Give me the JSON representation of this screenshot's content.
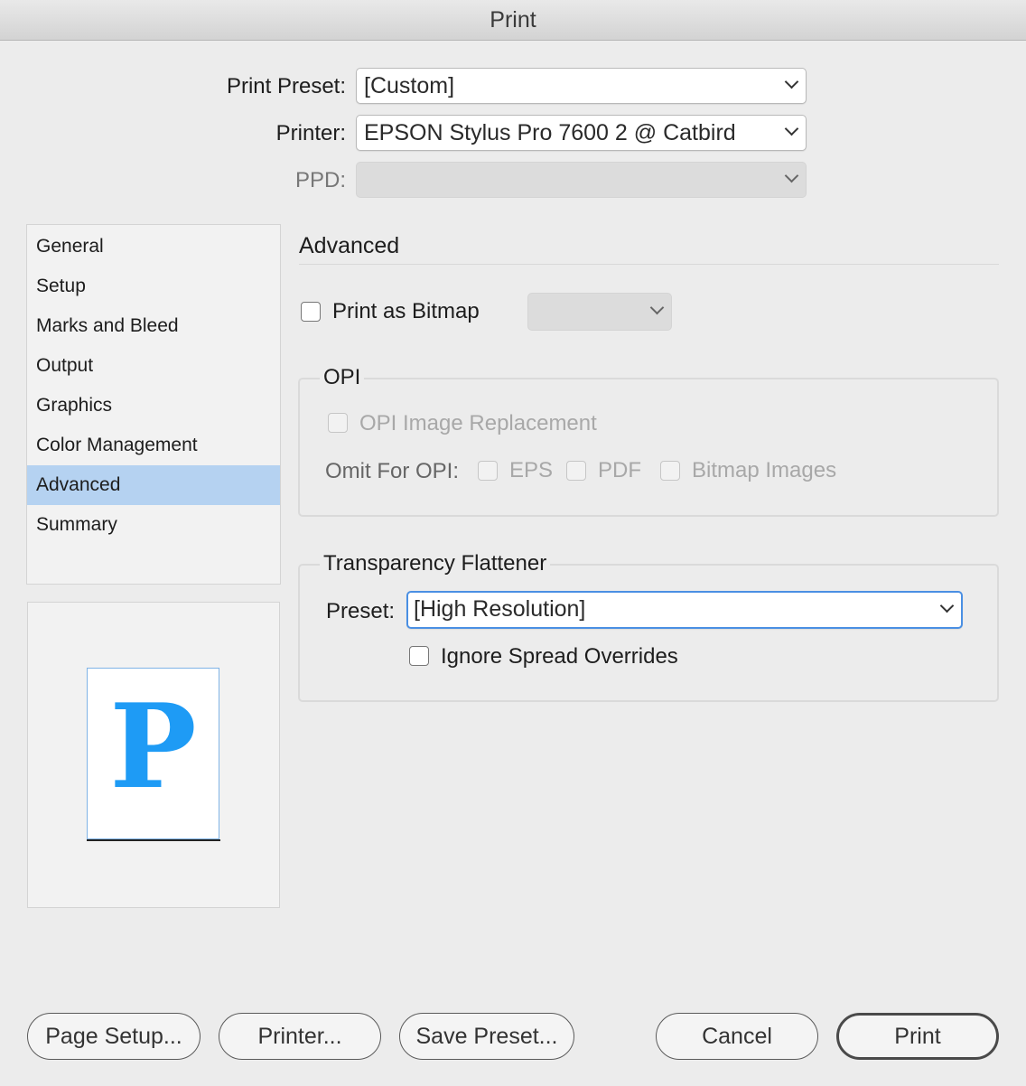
{
  "window": {
    "title": "Print"
  },
  "top": {
    "preset_label": "Print Preset:",
    "preset_value": "[Custom]",
    "printer_label": "Printer:",
    "printer_value": "EPSON Stylus Pro 7600 2 @ Catbird",
    "ppd_label": "PPD:",
    "ppd_value": ""
  },
  "sidebar": {
    "items": [
      {
        "label": "General"
      },
      {
        "label": "Setup"
      },
      {
        "label": "Marks and Bleed"
      },
      {
        "label": "Output"
      },
      {
        "label": "Graphics"
      },
      {
        "label": "Color Management"
      },
      {
        "label": "Advanced"
      },
      {
        "label": "Summary"
      }
    ],
    "selected": "Advanced"
  },
  "preview": {
    "letter": "P",
    "color": "#1e9bf5"
  },
  "advanced": {
    "title": "Advanced",
    "print_as_bitmap_label": "Print as Bitmap",
    "print_as_bitmap_checked": false,
    "bitmap_select_value": ""
  },
  "opi": {
    "legend": "OPI",
    "image_replacement_label": "OPI Image Replacement",
    "omit_label": "Omit For OPI:",
    "eps_label": "EPS",
    "pdf_label": "PDF",
    "bitmap_images_label": "Bitmap Images"
  },
  "flattener": {
    "legend": "Transparency Flattener",
    "preset_label": "Preset:",
    "preset_value": "[High Resolution]",
    "ignore_overrides_label": "Ignore Spread Overrides",
    "ignore_overrides_checked": false
  },
  "buttons": {
    "page_setup": "Page Setup...",
    "printer": "Printer...",
    "save_preset": "Save Preset...",
    "cancel": "Cancel",
    "print": "Print"
  },
  "colors": {
    "selection": "#b5d2f1",
    "focus_ring": "#4a8fe3"
  }
}
